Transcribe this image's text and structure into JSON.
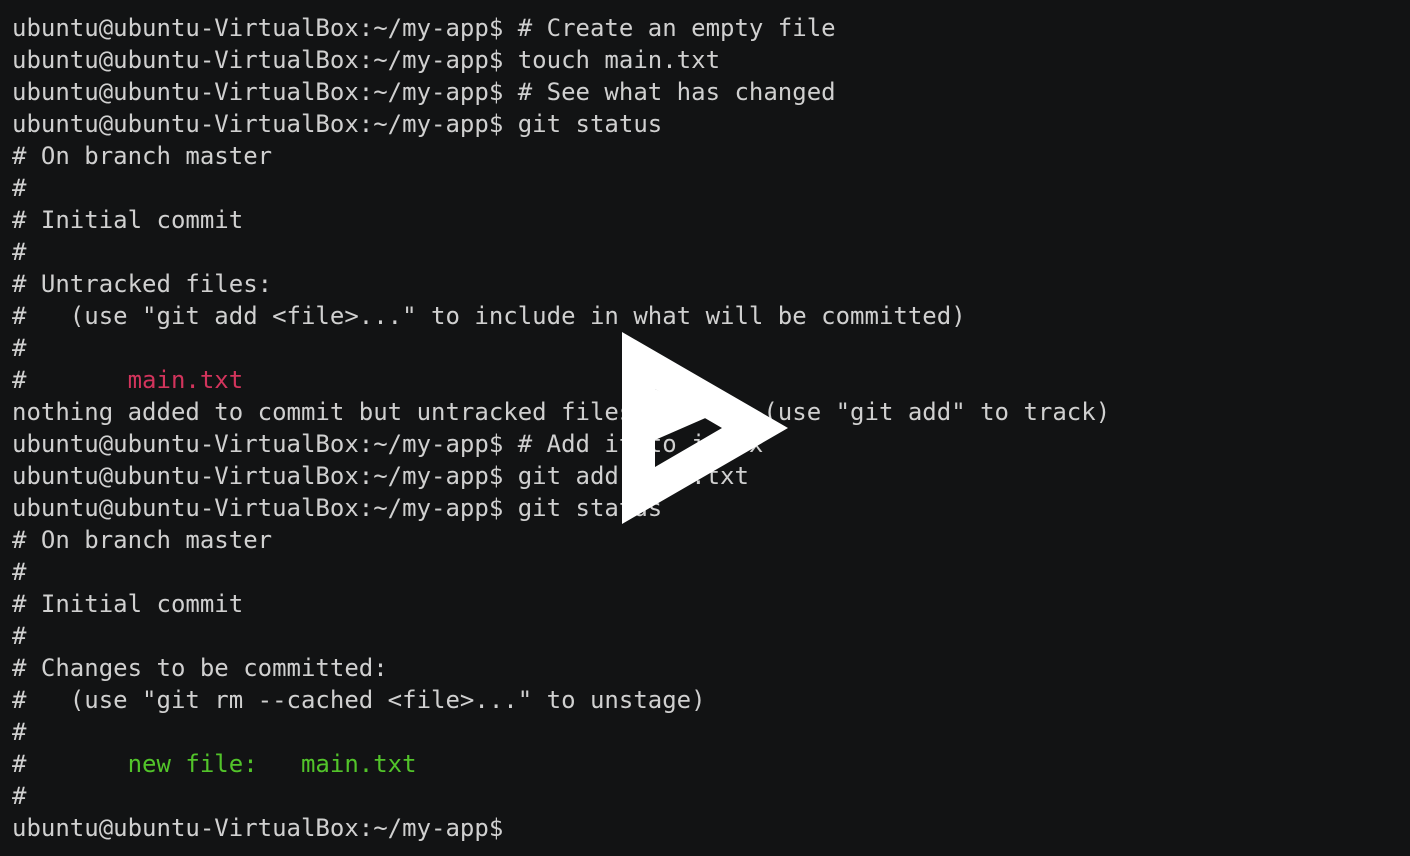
{
  "terminal": {
    "lines": [
      {
        "parts": [
          {
            "text": "ubuntu@ubuntu-VirtualBox:~/my-app$ # Create an empty file"
          }
        ]
      },
      {
        "parts": [
          {
            "text": "ubuntu@ubuntu-VirtualBox:~/my-app$ touch main.txt"
          }
        ]
      },
      {
        "parts": [
          {
            "text": "ubuntu@ubuntu-VirtualBox:~/my-app$ # See what has changed"
          }
        ]
      },
      {
        "parts": [
          {
            "text": "ubuntu@ubuntu-VirtualBox:~/my-app$ git status"
          }
        ]
      },
      {
        "parts": [
          {
            "text": "# On branch master"
          }
        ]
      },
      {
        "parts": [
          {
            "text": "#"
          }
        ]
      },
      {
        "parts": [
          {
            "text": "# Initial commit"
          }
        ]
      },
      {
        "parts": [
          {
            "text": "#"
          }
        ]
      },
      {
        "parts": [
          {
            "text": "# Untracked files:"
          }
        ]
      },
      {
        "parts": [
          {
            "text": "#   (use \"git add <file>...\" to include in what will be committed)"
          }
        ]
      },
      {
        "parts": [
          {
            "text": "#"
          }
        ]
      },
      {
        "parts": [
          {
            "text": "#       "
          },
          {
            "text": "main.txt",
            "color": "red"
          }
        ]
      },
      {
        "parts": [
          {
            "text": "nothing added to commit but untracked files present (use \"git add\" to track)"
          }
        ]
      },
      {
        "parts": [
          {
            "text": "ubuntu@ubuntu-VirtualBox:~/my-app$ # Add it to index"
          }
        ]
      },
      {
        "parts": [
          {
            "text": "ubuntu@ubuntu-VirtualBox:~/my-app$ git add main.txt"
          }
        ]
      },
      {
        "parts": [
          {
            "text": "ubuntu@ubuntu-VirtualBox:~/my-app$ git status"
          }
        ]
      },
      {
        "parts": [
          {
            "text": "# On branch master"
          }
        ]
      },
      {
        "parts": [
          {
            "text": "#"
          }
        ]
      },
      {
        "parts": [
          {
            "text": "# Initial commit"
          }
        ]
      },
      {
        "parts": [
          {
            "text": "#"
          }
        ]
      },
      {
        "parts": [
          {
            "text": "# Changes to be committed:"
          }
        ]
      },
      {
        "parts": [
          {
            "text": "#   (use \"git rm --cached <file>...\" to unstage)"
          }
        ]
      },
      {
        "parts": [
          {
            "text": "#"
          }
        ]
      },
      {
        "parts": [
          {
            "text": "#       "
          },
          {
            "text": "new file:   main.txt",
            "color": "green"
          }
        ]
      },
      {
        "parts": [
          {
            "text": "#"
          }
        ]
      },
      {
        "parts": [
          {
            "text": "ubuntu@ubuntu-VirtualBox:~/my-app$ "
          }
        ]
      }
    ]
  },
  "overlay": {
    "icon": "asciinema-play-icon",
    "color": "#ffffff"
  },
  "colors": {
    "background": "#121314",
    "foreground": "#d0d0d0",
    "red": "#d2345c",
    "green": "#52c42a"
  }
}
